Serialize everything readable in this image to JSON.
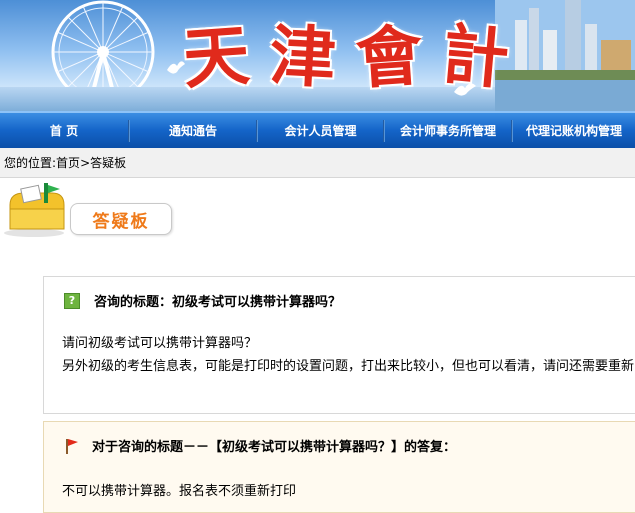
{
  "banner": {
    "title_chars": [
      "天",
      "津",
      "會",
      "計"
    ]
  },
  "nav": {
    "items": [
      "首    页",
      "通知通告",
      "会计人员管理",
      "会计师事务所管理",
      "代理记账机构管理"
    ]
  },
  "breadcrumb": {
    "prefix": "您的位置:",
    "home": "首页",
    "sep": ">",
    "current": "答疑板"
  },
  "board": {
    "title": "答疑板"
  },
  "question": {
    "title_label": "咨询的标题：",
    "title_text": "初级考试可以携带计算器吗？",
    "body_lines": [
      "请问初级考试可以携带计算器吗？",
      "另外初级的考生信息表，可能是打印时的设置问题，打出来比较小，但也可以看清，请问还需要重新"
    ]
  },
  "answer": {
    "title": "对于咨询的标题－－【初级考试可以携带计算器吗？】的答复：",
    "body": "不可以携带计算器。报名表不须重新打印"
  },
  "colors": {
    "nav_bg": "#1464c8",
    "title_red": "#e02a1c",
    "board_orange": "#ef7a1a",
    "answer_bg": "#fffaf0"
  },
  "icons": {
    "question": "question-mark-icon",
    "answer": "red-flag-icon",
    "board": "mailbox-icon"
  }
}
